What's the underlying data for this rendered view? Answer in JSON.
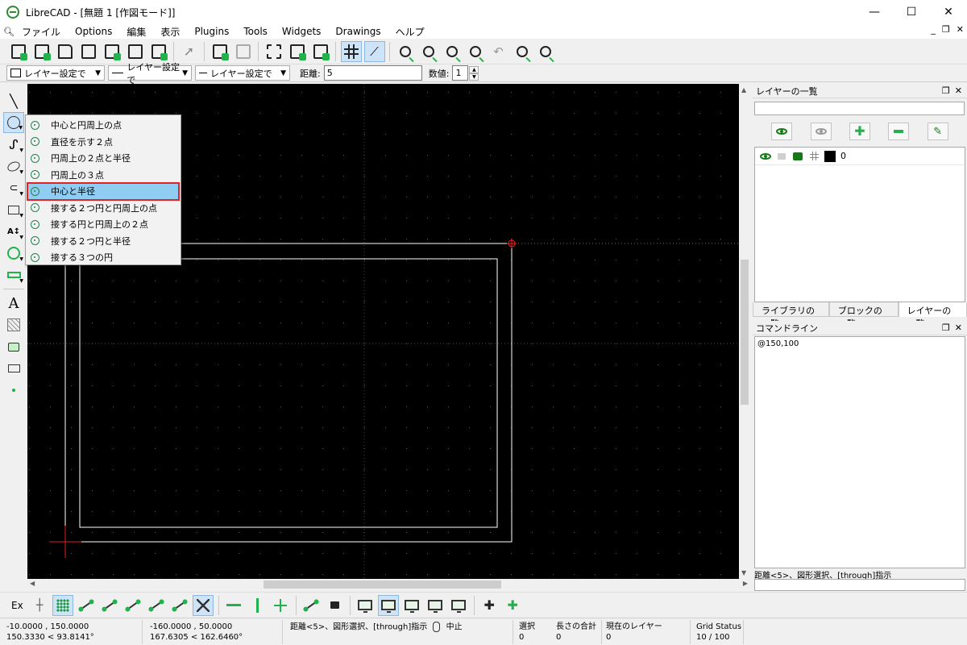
{
  "window": {
    "title": "LibreCAD - [無題 1 [作図モード]]",
    "min": "—",
    "max": "☐",
    "close": "✕"
  },
  "menu": [
    "ファイル",
    "Options",
    "編集",
    "表示",
    "Plugins",
    "Tools",
    "Widgets",
    "Drawings",
    "ヘルプ"
  ],
  "toolbar2": {
    "color_combo": "レイヤー設定で",
    "width_combo": "レイヤー設定で",
    "linetype_combo": "レイヤー設定で",
    "distance_label": "距離:",
    "distance_value": "5",
    "count_label": "数値:",
    "count_value": "1"
  },
  "circle_menu": [
    "中心と円周上の点",
    "直径を示す２点",
    "円周上の２点と半径",
    "円周上の３点",
    "中心と半径",
    "接する２つ円と円周上の点",
    "接する円と円周上の２点",
    "接する２つ円と半径",
    "接する３つの円"
  ],
  "layer_dock": {
    "title": "レイヤーの一覧",
    "layers": [
      {
        "name": "0",
        "color": "#000000"
      }
    ],
    "tabs": [
      "ライブラリの一覧",
      "ブロックの一覧",
      "レイヤーの一覧"
    ]
  },
  "cmd_dock": {
    "title": "コマンドライン",
    "history": "@150,100",
    "prompt": "距離<5>、図形選択、[through]指示"
  },
  "snapbar": {
    "ex_label": "Ex"
  },
  "status": {
    "abs_coord": "-10.0000 , 150.0000",
    "abs_polar": "150.3330 < 93.8141°",
    "rel_coord": "-160.0000 , 50.0000",
    "rel_polar": "167.6305 < 162.6460°",
    "command_hint": "距離<5>、図形選択、[through]指示",
    "right_click": "中止",
    "selected_label": "選択",
    "selected_value": "0",
    "total_length_label": "長さの合計",
    "total_length_value": "0",
    "current_layer_label": "現在のレイヤー",
    "current_layer_value": "0",
    "grid_label": "Grid Status",
    "grid_value": "10 / 100"
  }
}
